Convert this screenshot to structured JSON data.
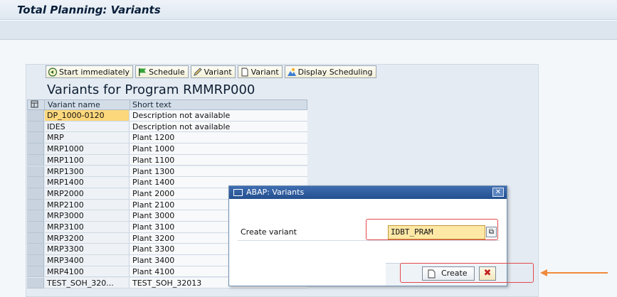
{
  "window": {
    "title": "Total Planning: Variants"
  },
  "toolbar": {
    "start_label": "Start immediately",
    "schedule_label": "Schedule",
    "variant_edit_label": "Variant",
    "variant_new_label": "Variant",
    "display_scheduling_label": "Display Scheduling"
  },
  "page": {
    "heading": "Variants for Program RMMRP000"
  },
  "table": {
    "columns": [
      "Variant name",
      "Short text"
    ],
    "rows": [
      {
        "name": "DP_1000-0120",
        "text": "Description not available"
      },
      {
        "name": "IDES",
        "text": "Description not available"
      },
      {
        "name": "MRP",
        "text": "Plant 1200"
      },
      {
        "name": "MRP1000",
        "text": "Plant 1000"
      },
      {
        "name": "MRP1100",
        "text": "Plant 1100"
      },
      {
        "name": "MRP1300",
        "text": "Plant 1300"
      },
      {
        "name": "MRP1400",
        "text": "Plant 1400"
      },
      {
        "name": "MRP2000",
        "text": "Plant 2000"
      },
      {
        "name": "MRP2100",
        "text": "Plant 2100"
      },
      {
        "name": "MRP3000",
        "text": "Plant 3000"
      },
      {
        "name": "MRP3100",
        "text": "Plant 3100"
      },
      {
        "name": "MRP3200",
        "text": "Plant 3200"
      },
      {
        "name": "MRP3300",
        "text": "Plant 3300"
      },
      {
        "name": "MRP3400",
        "text": "Plant 3400"
      },
      {
        "name": "MRP4100",
        "text": "Plant 4100"
      },
      {
        "name": "TEST_SOH_320...",
        "text": "TEST_SOH_32013"
      }
    ]
  },
  "dialog": {
    "title": "ABAP: Variants",
    "label": "Create variant",
    "input_value": "IDBT_PRAM",
    "create_label": "Create",
    "cancel_symbol": "✖"
  },
  "colors": {
    "highlight": "#e2494d",
    "arrow": "#f08a3c",
    "selection": "#fdd77b"
  }
}
